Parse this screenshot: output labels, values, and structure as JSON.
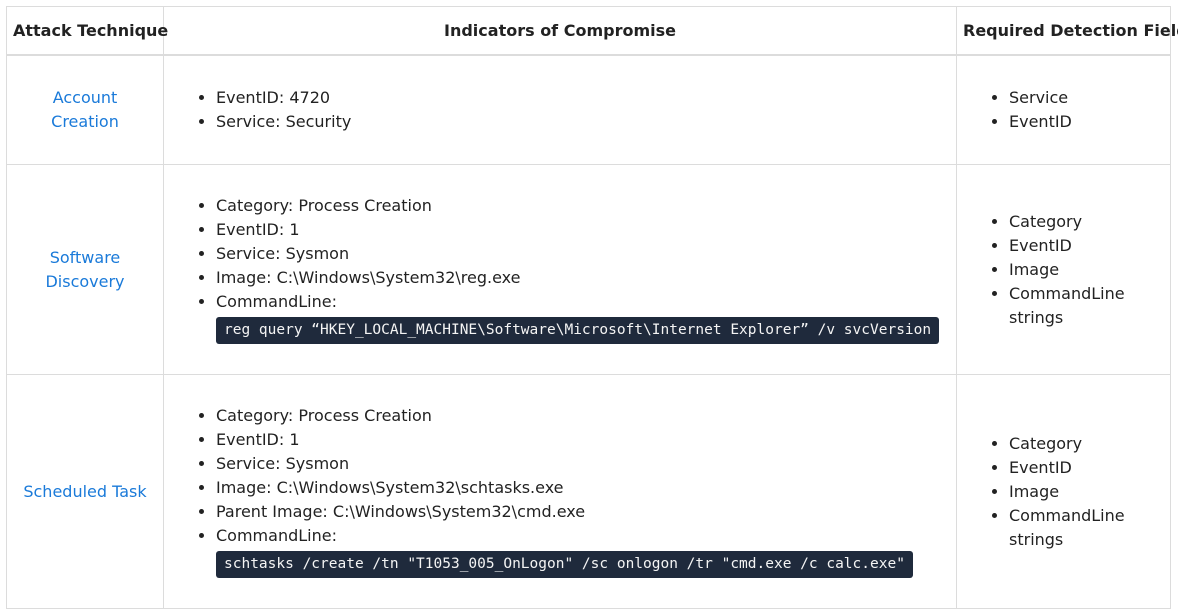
{
  "headers": {
    "technique": "Attack Technique",
    "indicators": "Indicators of Compromise",
    "fields": "Required Detection Fields"
  },
  "rows": [
    {
      "technique": "Account Creation",
      "indicators": [
        "EventID: 4720",
        "Service: Security"
      ],
      "fields": [
        "Service",
        "EventID"
      ]
    },
    {
      "technique_line1": "Software",
      "technique_line2": "Discovery",
      "indicators": [
        "Category: Process Creation",
        "EventID: 1",
        "Service: Sysmon",
        "Image: C:\\Windows\\System32\\reg.exe",
        "CommandLine:"
      ],
      "command": "reg query “HKEY_LOCAL_MACHINE\\Software\\Microsoft\\Internet Explorer” /v svcVersion",
      "fields": [
        "Category",
        "EventID",
        "Image",
        "CommandLine",
        "strings"
      ]
    },
    {
      "technique": "Scheduled Task",
      "indicators": [
        "Category: Process Creation",
        "EventID: 1",
        "Service: Sysmon",
        "Image: C:\\Windows\\System32\\schtasks.exe",
        "Parent Image: C:\\Windows\\System32\\cmd.exe",
        "CommandLine:"
      ],
      "command": "schtasks /create /tn \"T1053_005_OnLogon\" /sc onlogon /tr \"cmd.exe /c calc.exe\"",
      "fields": [
        "Category",
        "EventID",
        "Image",
        "CommandLine",
        "strings"
      ]
    }
  ],
  "colors": {
    "link": "#1a7ad9",
    "code_bg": "#1f2a3c",
    "border": "#dcdcdc"
  }
}
